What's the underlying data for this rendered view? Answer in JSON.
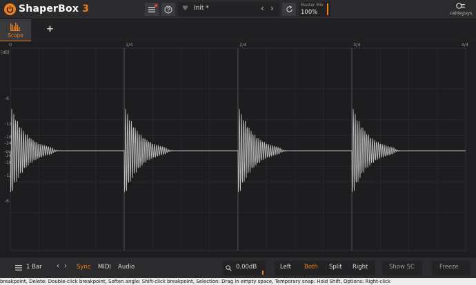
{
  "app": {
    "brand_main": "Shaper",
    "brand_box": "Box",
    "brand_version": "3"
  },
  "header": {
    "preset_name": "Init *",
    "master_mix_label": "Master Mix",
    "master_mix_value": "100%",
    "master_mix_level": 1.0,
    "company": "cableguys"
  },
  "tabs": {
    "scope_label": "Scope",
    "add_label": "+"
  },
  "scope": {
    "x_ticks": [
      "0",
      "1/4",
      "2/4",
      "3/4",
      "4/4"
    ],
    "y_unit": "[dB]",
    "y_ticks_upper": [
      "-6",
      "-12",
      "-18",
      "-24"
    ],
    "y_center": "-oo",
    "y_ticks_lower": [
      "-24",
      "-18",
      "-12",
      "-6"
    ],
    "waveform_color": "#bdbdbd",
    "grid_color": "#2c2c30",
    "beat_line_color": "#5a5a5e"
  },
  "bottom": {
    "length": "1 Bar",
    "sync": "Sync",
    "midi": "MIDI",
    "audio": "Audio",
    "gain": "0.00dB",
    "left": "Left",
    "both": "Both",
    "split": "Split",
    "right": "Right",
    "show_sc": "Show SC",
    "freeze": "Freeze"
  },
  "help_text": "breakpoint, Delete: Double-click breakpoint, Soften angle: Shift-click breakpoint, Selection: Drag in empty space, Temporary snap: Hold Shift, Options: Right-click",
  "colors": {
    "accent": "#ef7f1a",
    "notification": "#e8433a"
  }
}
